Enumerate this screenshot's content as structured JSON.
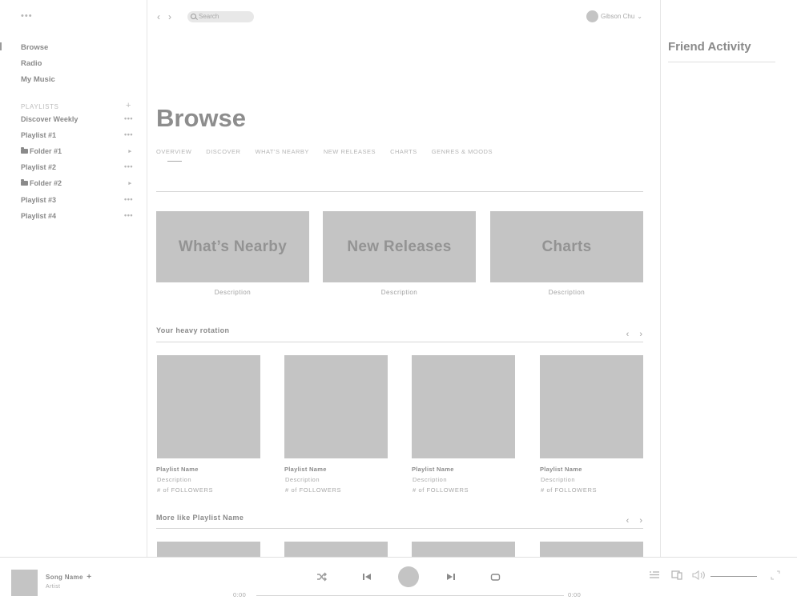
{
  "sidebar": {
    "top_menu": "•••",
    "nav": [
      {
        "label": "Browse"
      },
      {
        "label": "Radio"
      },
      {
        "label": "My Music"
      }
    ],
    "playlists_header": "PLAYLISTS",
    "add_symbol": "+",
    "playlists": [
      {
        "label": "Discover Weekly",
        "trail": "•••"
      },
      {
        "label": "Playlist #1",
        "trail": "•••"
      },
      {
        "label": "Folder #1",
        "trail": "▸"
      },
      {
        "label": "Playlist #2",
        "trail": "•••"
      },
      {
        "label": "Folder #2",
        "trail": "▸"
      },
      {
        "label": "Playlist #3",
        "trail": "•••"
      },
      {
        "label": "Playlist #4",
        "trail": "•••"
      }
    ]
  },
  "topbar": {
    "back": "‹",
    "forward": "›",
    "search_placeholder": "Search",
    "user_name": "Gibson Chu",
    "user_chevron": "⌄"
  },
  "main": {
    "title": "Browse",
    "tabs": [
      "OVERVIEW",
      "DISCOVER",
      "WHAT'S NEARBY",
      "NEW RELEASES",
      "CHARTS",
      "GENRES & MOODS"
    ],
    "tiles": [
      {
        "title": "What’s Nearby",
        "desc": "Description"
      },
      {
        "title": "New Releases",
        "desc": "Description"
      },
      {
        "title": "Charts",
        "desc": "Description"
      }
    ],
    "heavy_rotation": {
      "title": "Your heavy rotation",
      "prev": "‹",
      "next": "›",
      "cards": [
        {
          "name": "Playlist Name",
          "desc": "Description",
          "followers": "# of FOLLOWERS"
        },
        {
          "name": "Playlist Name",
          "desc": "Description",
          "followers": "# of FOLLOWERS"
        },
        {
          "name": "Playlist Name",
          "desc": "Description",
          "followers": "# of FOLLOWERS"
        },
        {
          "name": "Playlist Name",
          "desc": "Description",
          "followers": "# of FOLLOWERS"
        }
      ]
    },
    "more_like": {
      "title": "More like Playlist Name",
      "prev": "‹",
      "next": "›"
    }
  },
  "friends": {
    "title": "Friend Activity"
  },
  "player": {
    "song": "Song Name",
    "add": "+",
    "artist": "Artist",
    "elapsed": "0:00",
    "duration": "0:00"
  }
}
